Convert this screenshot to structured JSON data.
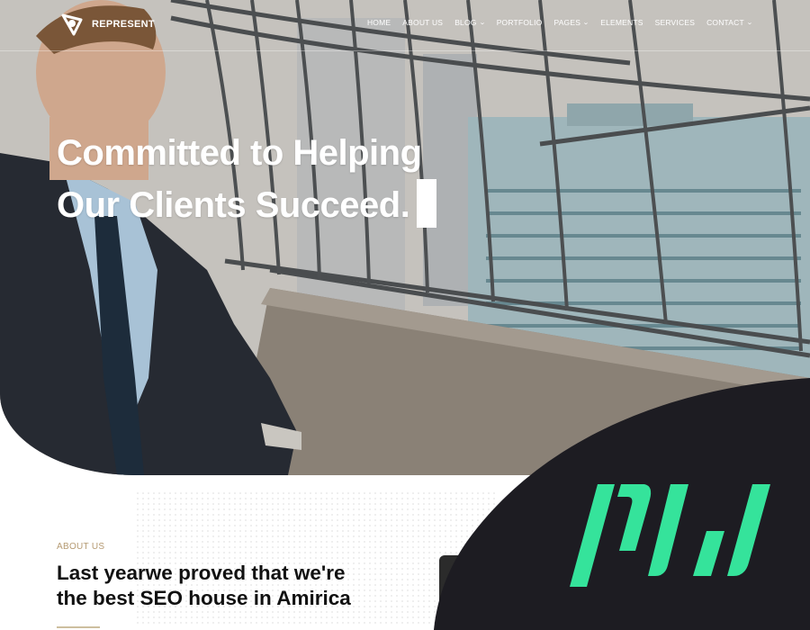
{
  "brand": {
    "name": "REPRESENT",
    "logo_icon": "triangle-logo-icon",
    "watermark_icon": "pw-logo-icon",
    "watermark_text": "PW",
    "watermark_color": "#35e39b",
    "watermark_bg": "#1d1c22"
  },
  "nav": {
    "items": [
      {
        "label": "HOME",
        "dropdown": false
      },
      {
        "label": "ABOUT US",
        "dropdown": false
      },
      {
        "label": "BLOG",
        "dropdown": true
      },
      {
        "label": "PORTFOLIO",
        "dropdown": false
      },
      {
        "label": "PAGES",
        "dropdown": true
      },
      {
        "label": "ELEMENTS",
        "dropdown": false
      },
      {
        "label": "SERVICES",
        "dropdown": false
      },
      {
        "label": "CONTACT",
        "dropdown": true
      }
    ]
  },
  "hero": {
    "title_line1": "Committed to Helping",
    "title_line2": "Our Clients Succeed."
  },
  "about": {
    "eyebrow": "ABOUT US",
    "heading_line1": "Last yearwe proved that we're",
    "heading_line2": "the best SEO house in Amirica",
    "accent_color": "#b59a72"
  }
}
